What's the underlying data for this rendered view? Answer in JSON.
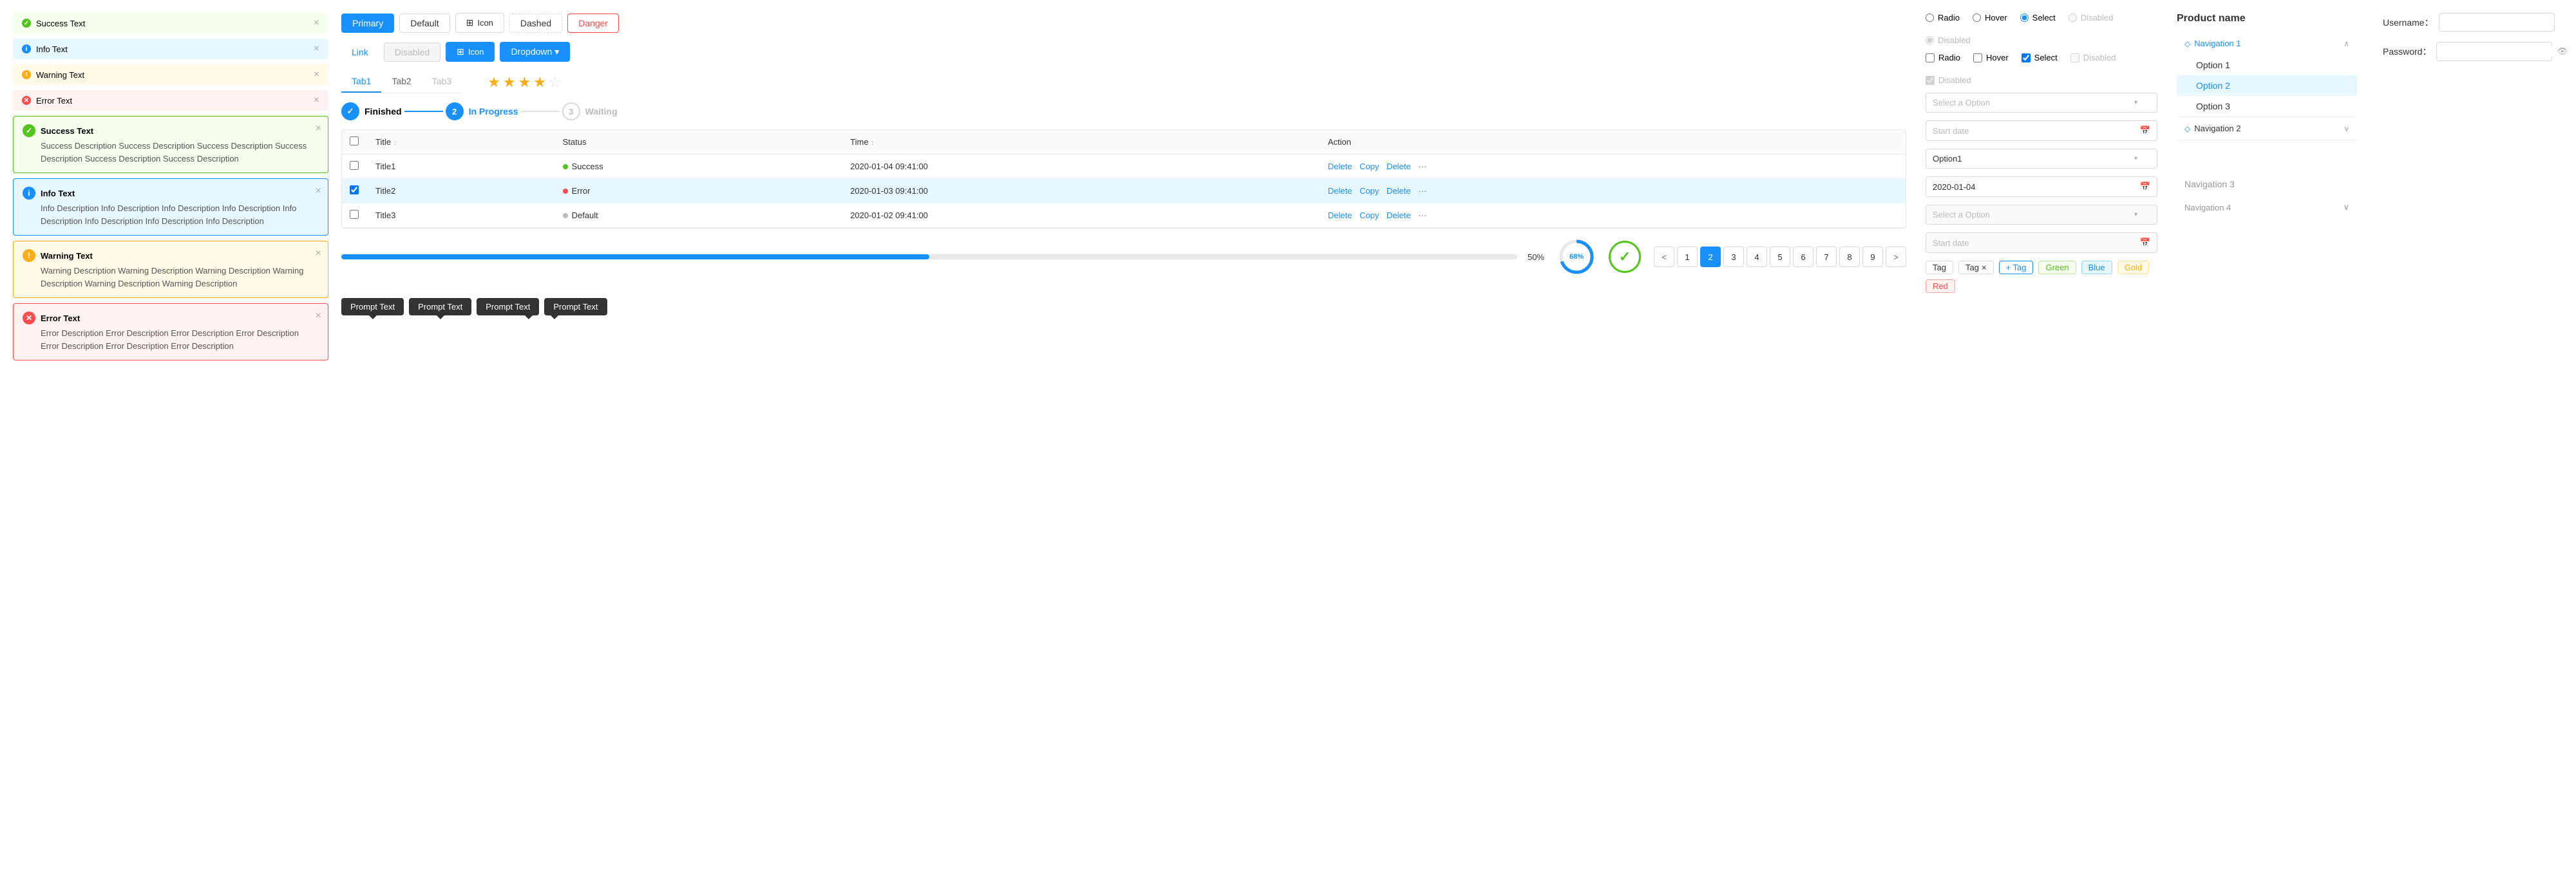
{
  "alerts": {
    "simple": [
      {
        "type": "success",
        "dotClass": "dot-success",
        "dotIcon": "✓",
        "text": "Success Text",
        "id": "alert-simple-success"
      },
      {
        "type": "info",
        "dotClass": "dot-info",
        "dotIcon": "i",
        "text": "Info Text",
        "id": "alert-simple-info"
      },
      {
        "type": "warning",
        "dotClass": "dot-warning",
        "dotIcon": "!",
        "text": "Warning Text",
        "id": "alert-simple-warning"
      },
      {
        "type": "error",
        "dotClass": "dot-error",
        "dotIcon": "✕",
        "text": "Error Text",
        "id": "alert-simple-error"
      }
    ],
    "detailed": [
      {
        "type": "success",
        "iconClass": "dot-success",
        "iconChar": "✓",
        "title": "Success Text",
        "desc": "Success Description Success Description Success Description Success Description Success Description Success Description"
      },
      {
        "type": "info",
        "iconClass": "dot-info",
        "iconChar": "i",
        "title": "Info Text",
        "desc": "Info Description Info Description Info Description Info Description Info Description Info Description Info Description Info Description"
      },
      {
        "type": "warning",
        "iconClass": "dot-warning",
        "iconChar": "!",
        "title": "Warning Text",
        "desc": "Warning Description Warning Description Warning Description Warning Description Warning Description Warning Description"
      },
      {
        "type": "error",
        "iconClass": "dot-error",
        "iconChar": "✕",
        "title": "Error Text",
        "desc": "Error Description Error Description Error Description Error Description Error Description Error Description Error Description"
      }
    ]
  },
  "buttons": {
    "row1": [
      {
        "label": "Primary",
        "class": "btn-primary"
      },
      {
        "label": "Default",
        "class": "btn-default"
      },
      {
        "label": "Icon",
        "class": "btn-icon",
        "hasIcon": true
      },
      {
        "label": "Dashed",
        "class": "btn-dashed"
      },
      {
        "label": "Danger",
        "class": "btn-danger"
      }
    ],
    "row2": [
      {
        "label": "Link",
        "class": "btn-link"
      },
      {
        "label": "Disabled",
        "class": "btn-disabled"
      },
      {
        "label": "Icon",
        "class": "btn-icon-blue",
        "hasIcon": true
      },
      {
        "label": "Dropdown ▾",
        "class": "btn-dropdown"
      }
    ]
  },
  "tabs": {
    "items": [
      {
        "label": "Tab1",
        "active": true
      },
      {
        "label": "Tab2",
        "active": false
      },
      {
        "label": "Tab3",
        "active": false,
        "disabled": true
      }
    ]
  },
  "stars": {
    "filled": 3,
    "half": 1,
    "empty": 1,
    "total": 5
  },
  "steps": [
    {
      "label": "Finished",
      "state": "done",
      "icon": "✓"
    },
    {
      "label": "In Progress",
      "state": "active",
      "num": "2"
    },
    {
      "label": "Waiting",
      "state": "waiting",
      "num": "3"
    }
  ],
  "table": {
    "columns": [
      "",
      "Title ↕",
      "Status",
      "Time ↕",
      "Action"
    ],
    "rows": [
      {
        "id": "row1",
        "checked": false,
        "title": "Title1",
        "status": "Success",
        "statusClass": "dot-green",
        "time": "2020-01-04  09:41:00",
        "selected": false
      },
      {
        "id": "row2",
        "checked": true,
        "title": "Title2",
        "status": "Error",
        "statusClass": "dot-red",
        "time": "2020-01-03  09:41:00",
        "selected": true
      },
      {
        "id": "row3",
        "checked": false,
        "title": "Title3",
        "status": "Default",
        "statusClass": "dot-gray",
        "time": "2020-01-02  09:41:00",
        "selected": false
      }
    ],
    "actions": [
      "Delete",
      "Copy",
      "Delete",
      "···"
    ]
  },
  "progress": {
    "bar": {
      "value": 50,
      "label": "50%"
    },
    "circle": {
      "value": 68,
      "label": "68%"
    },
    "checkCircle": {
      "icon": "✓"
    }
  },
  "tooltips": [
    {
      "label": "Prompt Text",
      "pos": "top"
    },
    {
      "label": "Prompt Text",
      "pos": "top"
    },
    {
      "label": "Prompt Text",
      "pos": "top"
    },
    {
      "label": "Prompt Text",
      "pos": "top"
    }
  ],
  "pagination": {
    "prev": "<",
    "next": ">",
    "pages": [
      1,
      2,
      3,
      4,
      5,
      6,
      7,
      8,
      9
    ],
    "active": 2
  },
  "tags": {
    "plain": [
      "Tag",
      "Tag"
    ],
    "addLabel": "+ Tag",
    "colored": [
      "Green",
      "Blue",
      "Gold",
      "Red"
    ],
    "colorClasses": [
      "tag-green",
      "tag-blue",
      "tag-gold",
      "tag-red"
    ]
  },
  "form": {
    "radios_row1": [
      {
        "label": "Radio",
        "state": "unchecked"
      },
      {
        "label": "Hover",
        "state": "unchecked"
      },
      {
        "label": "Select",
        "state": "checked"
      },
      {
        "label": "Disabled",
        "state": "disabled"
      },
      {
        "label": "Disabled",
        "state": "disabled"
      }
    ],
    "radios_row2": [
      {
        "label": "Radio",
        "state": "unchecked",
        "type": "checkbox"
      },
      {
        "label": "Hover",
        "state": "hover",
        "type": "checkbox"
      },
      {
        "label": "Select",
        "state": "checked",
        "type": "checkbox"
      },
      {
        "label": "Disabled",
        "state": "disabled",
        "type": "checkbox"
      },
      {
        "label": "Disabled",
        "state": "disabled_checked",
        "type": "checkbox"
      }
    ],
    "selects": [
      {
        "placeholder": "Select a Option",
        "value": null
      },
      {
        "placeholder": null,
        "value": "Option1"
      },
      {
        "placeholder": "Select a Option",
        "value": null
      }
    ],
    "dates": [
      {
        "placeholder": "Start date",
        "value": null
      },
      {
        "placeholder": null,
        "value": "2020-01-04"
      },
      {
        "placeholder": "Start date",
        "value": null
      }
    ]
  },
  "navigation": {
    "product_name": "Product name",
    "items": [
      {
        "label": "Navigation 1",
        "icon": "◇",
        "expanded": true,
        "active": true,
        "sub": [
          {
            "label": "Option 1",
            "active": false
          },
          {
            "label": "Option 2",
            "active": true
          },
          {
            "label": "Option 3",
            "active": false
          }
        ]
      },
      {
        "label": "Navigation 2",
        "icon": "◇",
        "expanded": false
      },
      {
        "label": "Navigation 3",
        "disabled": true
      },
      {
        "label": "Navigation 4",
        "disabled": true,
        "hasArrow": true
      }
    ]
  },
  "form_right": {
    "username_label": "Username：",
    "password_label": "Password：",
    "username_placeholder": "",
    "password_placeholder": ""
  }
}
